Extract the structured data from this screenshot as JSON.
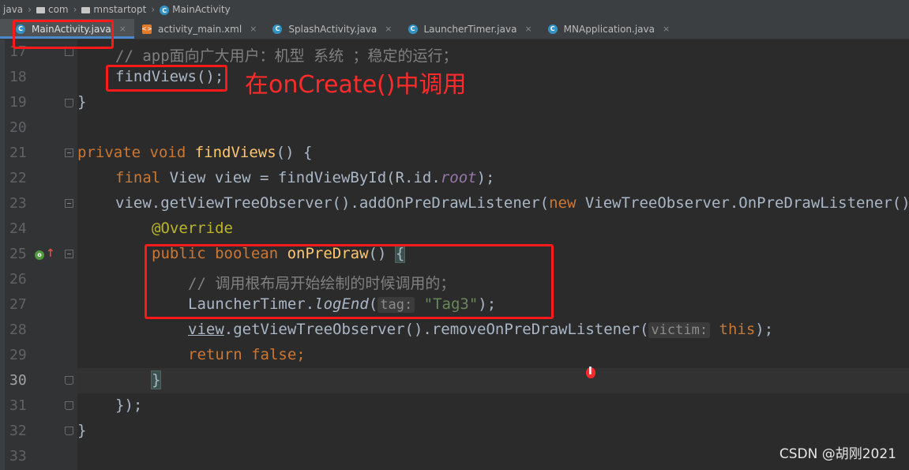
{
  "breadcrumb": [
    {
      "label": "java",
      "icon": "none"
    },
    {
      "label": "com",
      "icon": "folder-icon"
    },
    {
      "label": "mnstartopt",
      "icon": "folder-icon"
    },
    {
      "label": "MainActivity",
      "icon": "class-icon"
    }
  ],
  "tabs": [
    {
      "label": "MainActivity.java",
      "icon": "class-icon",
      "active": true
    },
    {
      "label": "activity_main.xml",
      "icon": "xml-icon",
      "active": false
    },
    {
      "label": "SplashActivity.java",
      "icon": "class-icon",
      "active": false
    },
    {
      "label": "LauncherTimer.java",
      "icon": "class-icon",
      "active": false
    },
    {
      "label": "MNApplication.java",
      "icon": "class-icon",
      "active": false
    }
  ],
  "close_glyph": "×",
  "line_numbers": [
    "17",
    "18",
    "19",
    "20",
    "21",
    "22",
    "23",
    "24",
    "25",
    "26",
    "27",
    "28",
    "29",
    "30",
    "31",
    "32",
    "33"
  ],
  "current_line": "30",
  "code": {
    "l17_comment": "// app面向广大用户：机型 系统 ；稳定的运行；",
    "l18_call": "findViews();",
    "l19_brace": "}",
    "l21_kw": "private void ",
    "l21_fn": "findViews",
    "l21_rest": "() {",
    "l22_kw": "final ",
    "l22_a": "View view = findViewById(R.id.",
    "l22_fld": "root",
    "l22_b": ");",
    "l23_a": "view.getViewTreeObserver().addOnPreDrawListener(",
    "l23_kw": "new ",
    "l23_b": "ViewTreeObserver.OnPreDrawListener()",
    "l24_ann": "@Override",
    "l25_kw": "public boolean ",
    "l25_fn": "onPreDraw",
    "l25_rest": "() ",
    "l25_brace": "{",
    "l26_comment": "// 调用根布局开始绘制的时候调用的；",
    "l27_a": "LauncherTimer.",
    "l27_method": "logEnd",
    "l27_paren": "(",
    "l27_hint": "tag:",
    "l27_str": "\"Tag3\"",
    "l27_end": ");",
    "l28_view": "view",
    "l28_a": ".getViewTreeObserver().removeOnPreDrawListener(",
    "l28_hint": "victim:",
    "l28_kw": "this",
    "l28_end": ");",
    "l29_kw": "return false",
    "l29_end": ";",
    "l30_brace": "}",
    "l31": "});",
    "l32": "}"
  },
  "annotation": "在onCreate()中调用",
  "watermark": "CSDN @胡刚2021",
  "colors": {
    "keyword": "#cc7832",
    "function": "#ffc66d",
    "annotation": "#bbb529",
    "comment": "#808080",
    "string": "#6a8759",
    "field": "#9876aa",
    "highlight_box": "#ff1a1a"
  }
}
